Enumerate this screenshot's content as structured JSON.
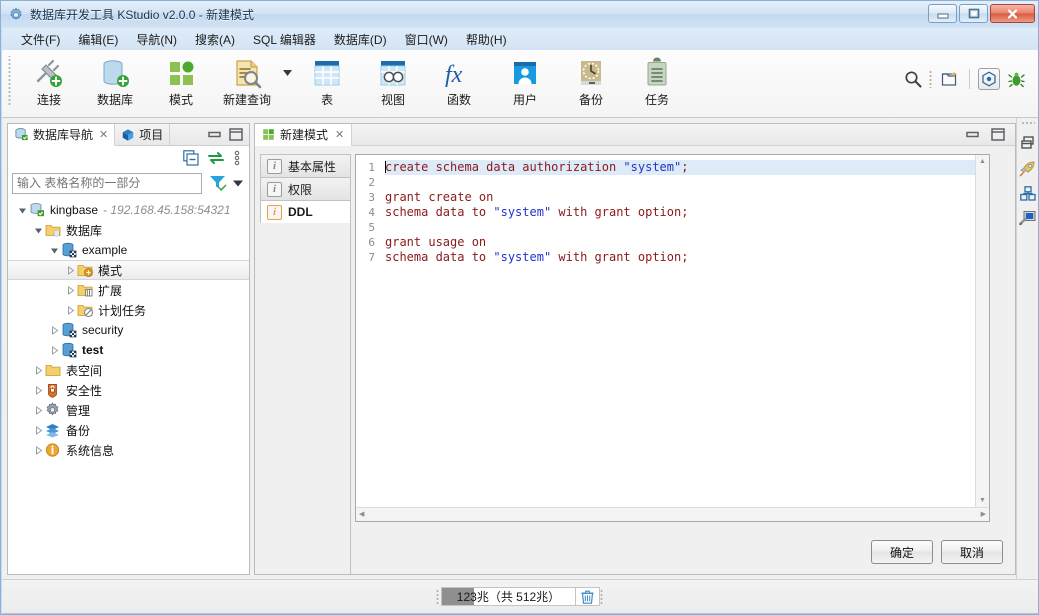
{
  "window": {
    "title": "数据库开发工具 KStudio v2.0.0 - 新建模式",
    "icon": "gear-icon",
    "controls": {
      "minimize": "minimize-icon",
      "maximize": "maximize-icon",
      "close": "close-icon"
    }
  },
  "menubar": {
    "items": [
      {
        "label": "文件(F)"
      },
      {
        "label": "编辑(E)"
      },
      {
        "label": "导航(N)"
      },
      {
        "label": "搜索(A)"
      },
      {
        "label": "SQL 编辑器"
      },
      {
        "label": "数据库(D)"
      },
      {
        "label": "窗口(W)"
      },
      {
        "label": "帮助(H)"
      }
    ]
  },
  "toolbar": {
    "buttons": [
      {
        "label": "连接",
        "icon": "new-connection-icon"
      },
      {
        "label": "数据库",
        "icon": "new-database-icon"
      },
      {
        "label": "模式",
        "icon": "new-schema-icon"
      },
      {
        "label": "新建查询",
        "icon": "new-query-icon"
      },
      {
        "label": "表",
        "icon": "new-table-icon"
      },
      {
        "label": "视图",
        "icon": "new-view-icon"
      },
      {
        "label": "函数",
        "icon": "new-function-icon"
      },
      {
        "label": "用户",
        "icon": "new-user-icon"
      },
      {
        "label": "备份",
        "icon": "backup-icon"
      },
      {
        "label": "任务",
        "icon": "task-icon"
      }
    ],
    "right_icons": [
      {
        "name": "search-icon"
      },
      {
        "name": "new-project-icon"
      },
      {
        "name": "perspective-icon"
      },
      {
        "name": "debug-bug-icon"
      }
    ]
  },
  "navigator": {
    "tabs": [
      {
        "label": "数据库导航",
        "icon": "database-nav-icon",
        "active": true,
        "closable": true
      },
      {
        "label": "项目",
        "icon": "project-cube-icon",
        "active": false,
        "closable": false
      }
    ],
    "panel_buttons": [
      {
        "name": "minimize-panel-icon"
      },
      {
        "name": "maximize-panel-icon"
      }
    ],
    "toolbar_icons": [
      {
        "name": "collapse-all-icon"
      },
      {
        "name": "link-editor-icon"
      },
      {
        "name": "view-menu-icon"
      }
    ],
    "filter": {
      "placeholder": "输入 表格名称的一部分",
      "value": "",
      "filter_icon": "filter-icon",
      "dropdown_icon": "chevron-down-icon"
    },
    "tree": [
      {
        "label": "kingbase",
        "sub": "- 192.168.45.158:54321",
        "indent": 0,
        "icon": "server-db-icon",
        "expanded": true,
        "selected": false,
        "bold": false
      },
      {
        "label": "数据库",
        "sub": "",
        "indent": 1,
        "icon": "db-folder-icon",
        "expanded": true,
        "selected": false,
        "bold": false
      },
      {
        "label": "example",
        "sub": "",
        "indent": 2,
        "icon": "database-icon",
        "expanded": true,
        "selected": false,
        "bold": false
      },
      {
        "label": "模式",
        "sub": "",
        "indent": 3,
        "icon": "schema-folder-icon",
        "expanded": false,
        "selected": true,
        "bold": false
      },
      {
        "label": "扩展",
        "sub": "",
        "indent": 3,
        "icon": "extension-folder-icon",
        "expanded": false,
        "selected": false,
        "bold": false
      },
      {
        "label": "计划任务",
        "sub": "",
        "indent": 3,
        "icon": "job-folder-icon",
        "expanded": false,
        "selected": false,
        "bold": false
      },
      {
        "label": "security",
        "sub": "",
        "indent": 2,
        "icon": "database-icon",
        "expanded": false,
        "selected": false,
        "bold": false
      },
      {
        "label": "test",
        "sub": "",
        "indent": 2,
        "icon": "database-icon",
        "expanded": false,
        "selected": false,
        "bold": true
      },
      {
        "label": "表空间",
        "sub": "",
        "indent": 1,
        "icon": "folder-icon",
        "expanded": false,
        "selected": false,
        "bold": false
      },
      {
        "label": "安全性",
        "sub": "",
        "indent": 1,
        "icon": "security-icon",
        "expanded": false,
        "selected": false,
        "bold": false
      },
      {
        "label": "管理",
        "sub": "",
        "indent": 1,
        "icon": "admin-gear-icon",
        "expanded": false,
        "selected": false,
        "bold": false
      },
      {
        "label": "备份",
        "sub": "",
        "indent": 1,
        "icon": "backup-stack-icon",
        "expanded": false,
        "selected": false,
        "bold": false
      },
      {
        "label": "系统信息",
        "sub": "",
        "indent": 1,
        "icon": "info-icon",
        "expanded": false,
        "selected": false,
        "bold": false
      }
    ]
  },
  "editor": {
    "tabs": [
      {
        "label": "新建模式",
        "icon": "new-schema-icon",
        "active": true,
        "closable": true
      }
    ],
    "panel_buttons": [
      {
        "name": "minimize-panel-icon"
      },
      {
        "name": "maximize-panel-icon"
      }
    ],
    "property_tabs": [
      {
        "label": "基本属性",
        "icon": "info-i-icon",
        "active": false
      },
      {
        "label": "权限",
        "icon": "info-i-icon",
        "active": false
      },
      {
        "label": "DDL",
        "icon": "info-i-icon",
        "active": true
      }
    ],
    "code": {
      "language": "sql",
      "current_line": 1,
      "lines": [
        {
          "n": 1,
          "text": "create schema data authorization \"system\";",
          "current": true
        },
        {
          "n": 2,
          "text": "",
          "current": false
        },
        {
          "n": 3,
          "text": "grant create on",
          "current": false
        },
        {
          "n": 4,
          "text": "schema data to \"system\" with grant option;",
          "current": false
        },
        {
          "n": 5,
          "text": "",
          "current": false
        },
        {
          "n": 6,
          "text": "grant usage on",
          "current": false
        },
        {
          "n": 7,
          "text": "schema data to \"system\" with grant option;",
          "current": false
        }
      ],
      "colors": {
        "text": "#8b1a1a",
        "string": "#2233cc",
        "current_line_bg": "#ddeaf7",
        "gutter": "#8c8c8c"
      }
    },
    "buttons": [
      {
        "label": "确定",
        "name": "ok-button"
      },
      {
        "label": "取消",
        "name": "cancel-button"
      }
    ]
  },
  "right_strip": {
    "icons": [
      {
        "name": "restore-panel-icon"
      },
      {
        "name": "rocket-icon"
      },
      {
        "name": "project-explorer-icon"
      },
      {
        "name": "remote-monitor-icon"
      }
    ]
  },
  "statusbar": {
    "heap": {
      "text": "123兆（共 512兆）",
      "used_mb": 123,
      "total_mb": 512,
      "percent": 24
    },
    "trash_icon": "trash-icon"
  },
  "colors": {
    "titlebar_start": "#e4eff9",
    "titlebar_end": "#d2e3f4",
    "window_border": "#8ab0d8",
    "accent_blue": "#1e8ad6",
    "sql_text": "#8b1a1a",
    "sql_string": "#2233cc",
    "selection_bg": "#ddeaf7"
  }
}
